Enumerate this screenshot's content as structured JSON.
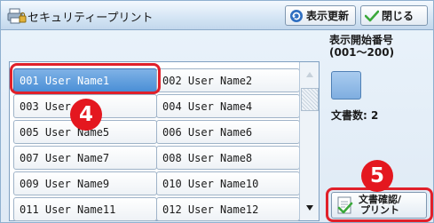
{
  "window": {
    "title": "セキュリティープリント",
    "refresh_label": "表示更新",
    "close_label": "閉じる"
  },
  "list": {
    "items": [
      "001 User Name1",
      "002 User Name2",
      "003 User",
      "004 User Name4",
      "005 User Name5",
      "006 User Name6",
      "007 User Name7",
      "008 User Name8",
      "009 User Name9",
      "010 User Name10",
      "011 User Name11",
      "012 User Name12"
    ],
    "selected_index": 0
  },
  "side": {
    "start_number_label": "表示開始番号\n(001〜200)",
    "start_number_value": "",
    "doc_count_label": "文書数:",
    "doc_count_value": "2",
    "confirm_print_label": "文書確認/\nプリント"
  },
  "callouts": [
    "4",
    "5"
  ],
  "colors": {
    "marker": "#e4171f",
    "selected": "#4a8fd6",
    "accent_check": "#3aa83a"
  },
  "icons": [
    "printer-lock-icon",
    "refresh-icon",
    "checkmark-icon",
    "scroll-up-icon",
    "scroll-down-icon",
    "document-check-icon"
  ]
}
